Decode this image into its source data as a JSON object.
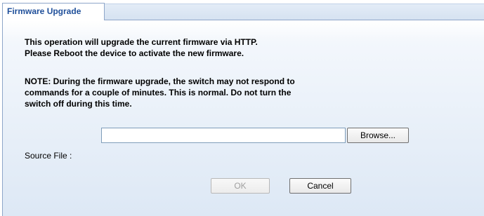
{
  "tab": {
    "label": "Firmware Upgrade"
  },
  "description": {
    "line1": "This operation will upgrade the current firmware via HTTP.",
    "line2": "Please Reboot the device to activate the new firmware."
  },
  "note": {
    "line1": "NOTE: During the firmware upgrade, the switch may not respond to",
    "line2": "commands for a couple of minutes. This is normal. Do not turn the",
    "line3": "switch off during this time."
  },
  "source_file": {
    "label": "Source File :",
    "value": "",
    "browse_label": "Browse..."
  },
  "actions": {
    "ok_label": "OK",
    "ok_enabled": false,
    "cancel_label": "Cancel"
  }
}
